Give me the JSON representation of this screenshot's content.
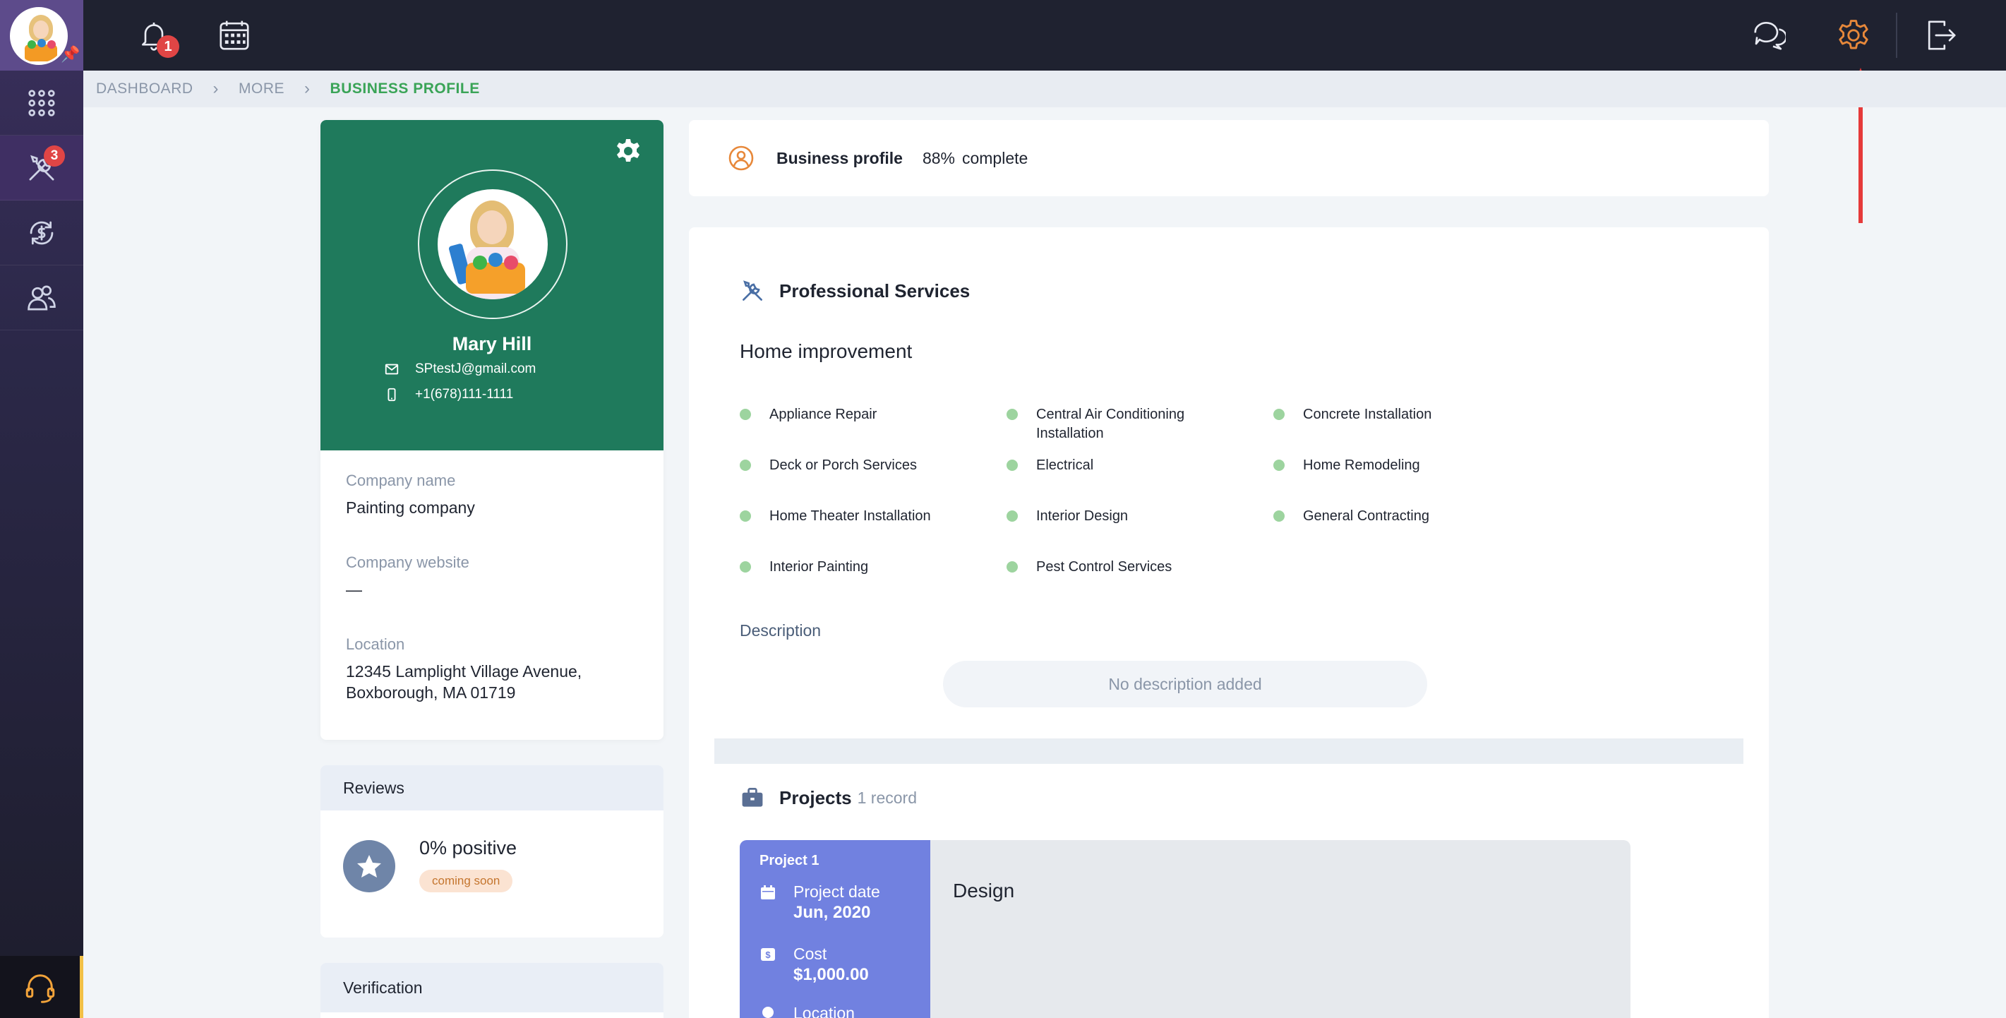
{
  "topbar": {
    "notifications_count": "1"
  },
  "rail": {
    "tools_badge": "3"
  },
  "breadcrumb": [
    "DASHBOARD",
    "MORE",
    "BUSINESS PROFILE"
  ],
  "profile": {
    "name": "Mary Hill",
    "email": "SPtestJ@gmail.com",
    "phone": "+1(678)111-1111",
    "company_name_label": "Company name",
    "company_name": "Painting company",
    "company_website_label": "Company website",
    "company_website": "—",
    "location_label": "Location",
    "location_line1": "12345 Lamplight Village Avenue,",
    "location_line2": "Boxborough, MA 01719"
  },
  "reviews": {
    "title": "Reviews",
    "positive": "0% positive",
    "badge": "coming soon"
  },
  "verification": {
    "title": "Verification"
  },
  "business_profile": {
    "title": "Business profile",
    "percent": "88%",
    "complete_label": "complete"
  },
  "services": {
    "title": "Professional Services",
    "category": "Home improvement",
    "items": [
      "Appliance Repair",
      "Central Air Conditioning Installation",
      "Concrete Installation",
      "Deck or Porch Services",
      "Electrical",
      "Home Remodeling",
      "Home Theater Installation",
      "Interior Design",
      "General Contracting",
      "Interior Painting",
      "Pest Control Services"
    ],
    "description_label": "Description",
    "description_empty": "No description added"
  },
  "projects": {
    "title": "Projects",
    "count": "1 record",
    "items": [
      {
        "label": "Project 1",
        "date_label": "Project date",
        "date": "Jun, 2020",
        "cost_label": "Cost",
        "cost": "$1,000.00",
        "location_label": "Location",
        "name": "Design"
      }
    ]
  },
  "colors": {
    "profile_header": "#1f7a5c",
    "breadcrumb_active": "#3aa457",
    "project_side": "#7181e0",
    "accent_orange": "#e7883a",
    "badge_red": "#e04545"
  }
}
